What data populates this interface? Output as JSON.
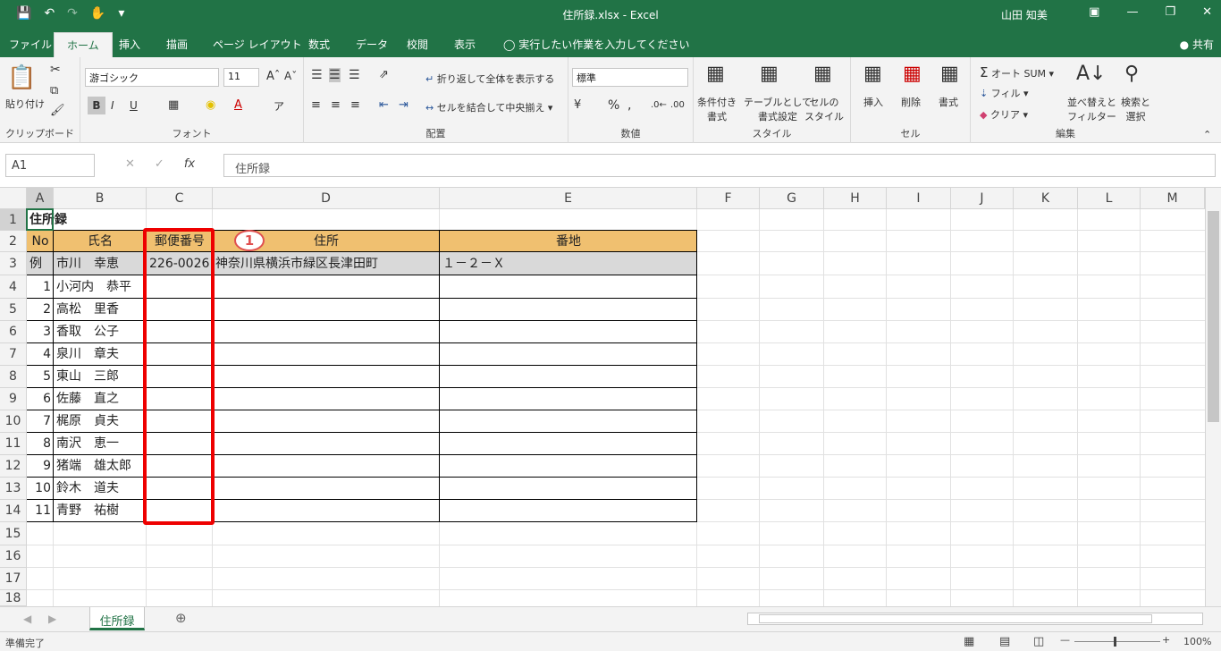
{
  "window": {
    "title": "住所録.xlsx - Excel",
    "user": "山田 知美"
  },
  "tabs": [
    "ファイル",
    "ホーム",
    "挿入",
    "描画",
    "ページ レイアウト",
    "数式",
    "データ",
    "校閲",
    "表示"
  ],
  "tell_me": "実行したい作業を入力してください",
  "share": "共有",
  "ribbon": {
    "clipboard": {
      "paste": "貼り付け",
      "label": "クリップボード"
    },
    "font": {
      "name": "游ゴシック",
      "size": "11",
      "label": "フォント",
      "bold": "B",
      "italic": "I",
      "underline": "U"
    },
    "alignment": {
      "wrap": "折り返して全体を表示する",
      "merge": "セルを結合して中央揃え",
      "label": "配置"
    },
    "number": {
      "format": "標準",
      "label": "数値",
      "percent": "%",
      "comma": ","
    },
    "styles": {
      "conditional": "条件付き\n書式",
      "table": "テーブルとして\n書式設定",
      "cell": "セルの\nスタイル",
      "label": "スタイル"
    },
    "cells": {
      "insert": "挿入",
      "delete": "削除",
      "format": "書式",
      "label": "セル"
    },
    "editing": {
      "autosum": "オート SUM",
      "fill": "フィル",
      "clear": "クリア",
      "sort": "並べ替えと\nフィルター",
      "find": "検索と\n選択",
      "label": "編集"
    }
  },
  "formula_bar": {
    "name_box": "A1",
    "content": "住所録"
  },
  "columns": [
    "A",
    "B",
    "C",
    "D",
    "E",
    "F",
    "G",
    "H",
    "I",
    "J",
    "K",
    "L",
    "M"
  ],
  "rows": [
    "1",
    "2",
    "3",
    "4",
    "5",
    "6",
    "7",
    "8",
    "9",
    "10",
    "11",
    "12",
    "13",
    "14",
    "15",
    "16",
    "17",
    "18"
  ],
  "sheet": {
    "title": "住所録",
    "headers": {
      "no": "No",
      "name": "氏名",
      "zip": "郵便番号",
      "address": "住所",
      "banchi": "番地"
    },
    "example": {
      "no": "例",
      "name": "市川　幸恵",
      "zip": "226-0026",
      "address": "神奈川県横浜市緑区長津田町",
      "banchi": "１－２－Ｘ"
    },
    "records": [
      {
        "no": "1",
        "name": "小河内　恭平"
      },
      {
        "no": "2",
        "name": "高松　里香"
      },
      {
        "no": "3",
        "name": "香取　公子"
      },
      {
        "no": "4",
        "name": "泉川　章夫"
      },
      {
        "no": "5",
        "name": "東山　三郎"
      },
      {
        "no": "6",
        "name": "佐藤　直之"
      },
      {
        "no": "7",
        "name": "梶原　貞夫"
      },
      {
        "no": "8",
        "name": "南沢　恵一"
      },
      {
        "no": "9",
        "name": "猪端　雄太郎"
      },
      {
        "no": "10",
        "name": "鈴木　道夫"
      },
      {
        "no": "11",
        "name": "青野　祐樹"
      }
    ]
  },
  "annotation": {
    "marker": "1"
  },
  "sheet_tab": "住所録",
  "status": {
    "ready": "準備完了",
    "zoom": "100%"
  },
  "colors": {
    "accent": "#217346",
    "header_fill": "#f0c070",
    "example_fill": "#d9d9d9",
    "highlight": "#ee0000"
  }
}
